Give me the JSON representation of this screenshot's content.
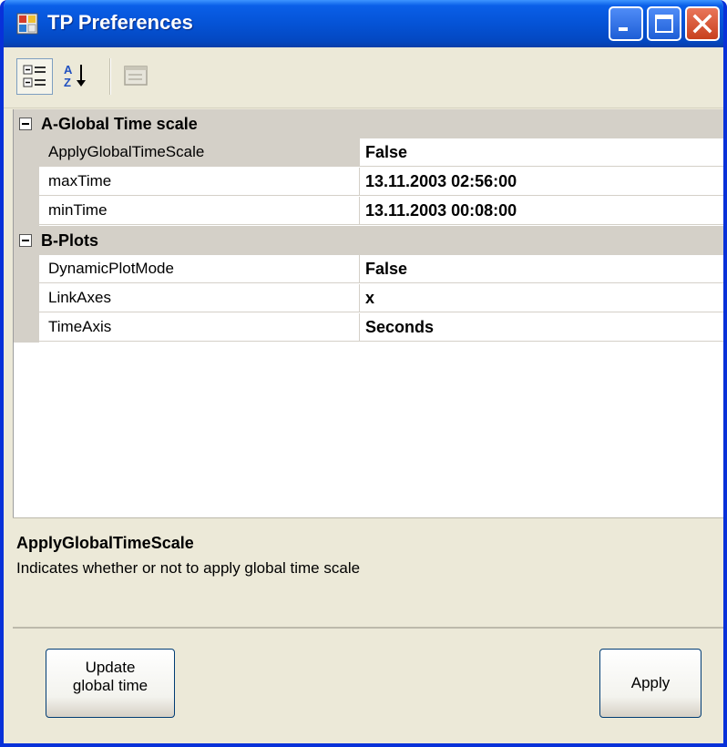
{
  "window": {
    "title": "TP Preferences"
  },
  "titlebar_buttons": [
    "minimize-icon",
    "maximize-icon",
    "close-icon"
  ],
  "toolbar": {
    "items": [
      "categorized-icon",
      "alphabetical-icon",
      "property-pages-icon"
    ]
  },
  "property_grid": {
    "categories": [
      {
        "label": "A-Global Time scale",
        "properties": [
          {
            "name": "ApplyGlobalTimeScale",
            "value": "False"
          },
          {
            "name": "maxTime",
            "value": "13.11.2003 02:56:00"
          },
          {
            "name": "minTime",
            "value": "13.11.2003 00:08:00"
          }
        ]
      },
      {
        "label": "B-Plots",
        "properties": [
          {
            "name": "DynamicPlotMode",
            "value": "False"
          },
          {
            "name": "LinkAxes",
            "value": "x"
          },
          {
            "name": "TimeAxis",
            "value": "Seconds"
          }
        ]
      }
    ],
    "selected_property": "ApplyGlobalTimeScale"
  },
  "help": {
    "title": "ApplyGlobalTimeScale",
    "description": "Indicates whether or not to apply global time scale"
  },
  "buttons": {
    "update_line1": "Update",
    "update_line2": "global time",
    "apply": "Apply"
  },
  "colors": {
    "titlebar": "#0553d6",
    "window_bg": "#ece9d8",
    "grid_line": "#d4d0c8",
    "close_button": "#c8401e"
  }
}
